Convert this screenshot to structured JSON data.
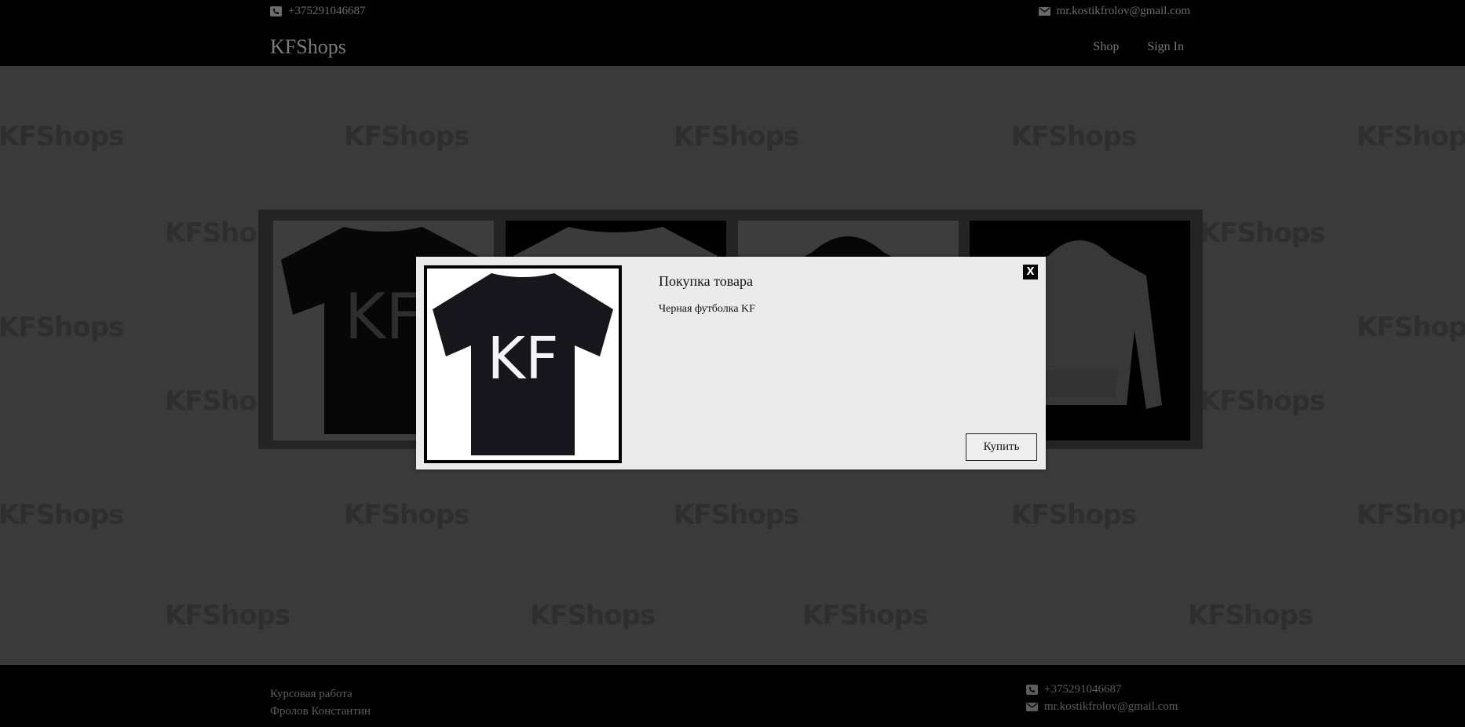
{
  "header": {
    "phone": "+375291046687",
    "email": "mr.kostikfrolov@gmail.com",
    "logo": "KFShops",
    "nav": [
      "Shop",
      "Sign In"
    ]
  },
  "watermark": "KFShops",
  "footer": {
    "line1": "Курсовая работа",
    "line2": "Фролов Константин",
    "phone": "+375291046687",
    "email": "mr.kostikfrolov@gmail.com"
  },
  "modal": {
    "title": "Покупка товара",
    "description": "Черная футболка KF",
    "close_label": "X",
    "buy_label": "Купить",
    "image_text": "KF"
  },
  "gallery": {
    "items": [
      "black-tshirt-kf",
      "white-tshirt",
      "black-hoodie",
      "grey-hoodie"
    ],
    "tshirt_text": "KF"
  },
  "icons": {
    "phone": "phone-icon",
    "email": "email-icon"
  },
  "colors": {
    "topbar": "#000000",
    "overlay": "#3a3a3a",
    "modal": "#ebebeb"
  }
}
